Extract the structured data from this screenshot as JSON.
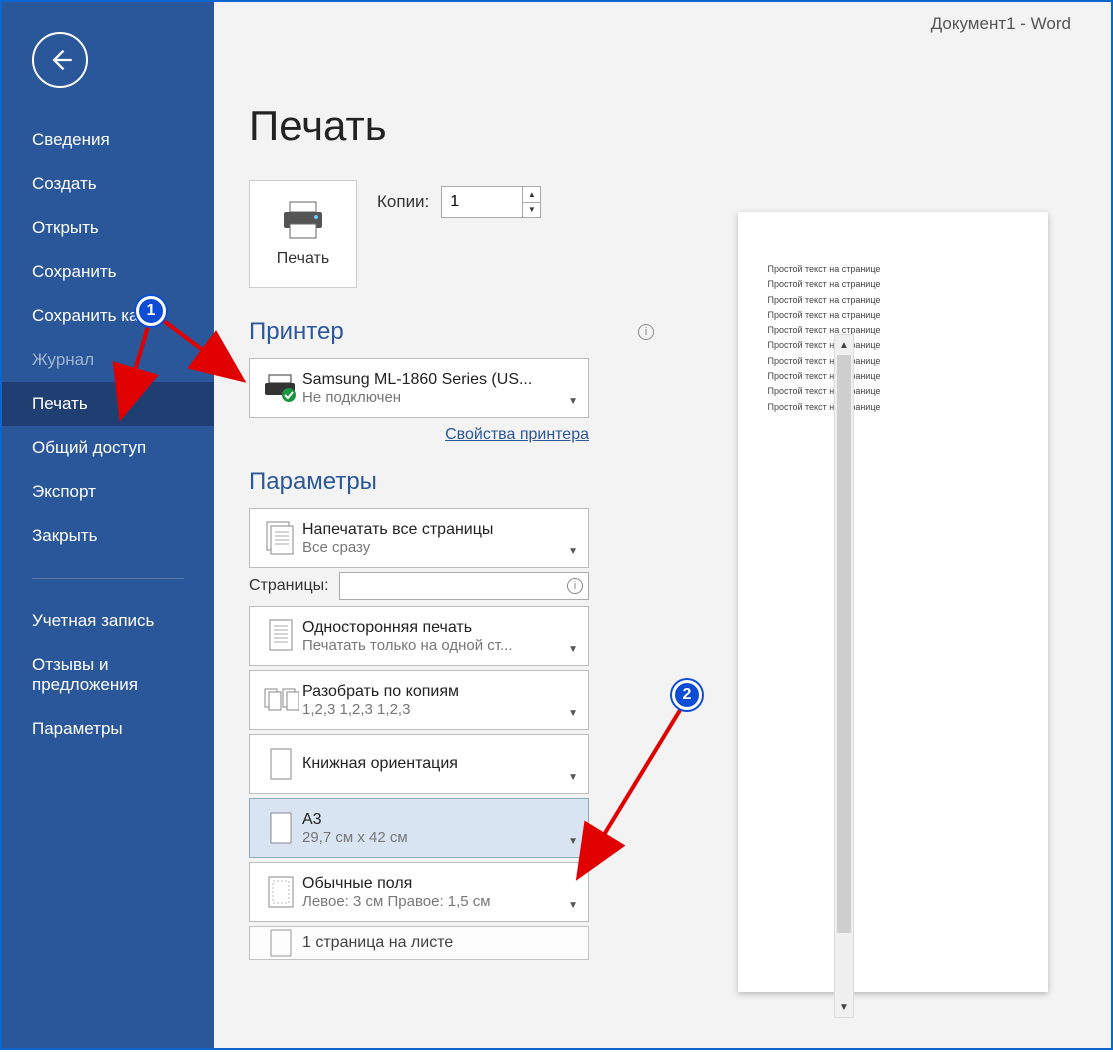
{
  "title_bar": "Документ1  -  Word",
  "sidebar": {
    "items": [
      {
        "label": "Сведения"
      },
      {
        "label": "Создать"
      },
      {
        "label": "Открыть"
      },
      {
        "label": "Сохранить"
      },
      {
        "label": "Сохранить как"
      },
      {
        "label": "Журнал",
        "disabled": true
      },
      {
        "label": "Печать",
        "active": true
      },
      {
        "label": "Общий доступ"
      },
      {
        "label": "Экспорт"
      },
      {
        "label": "Закрыть"
      }
    ],
    "secondary": [
      {
        "label": "Учетная запись"
      },
      {
        "label": "Отзывы и предложения"
      },
      {
        "label": "Параметры"
      }
    ]
  },
  "page_title": "Печать",
  "print_button_label": "Печать",
  "copies": {
    "label": "Копии:",
    "value": "1"
  },
  "printer_section": "Принтер",
  "printer": {
    "name": "Samsung ML-1860 Series (US...",
    "status": "Не подключен"
  },
  "printer_properties_link": "Свойства принтера",
  "settings_section": "Параметры",
  "settings": {
    "pages_all": {
      "main": "Напечатать все страницы",
      "sub": "Все сразу"
    },
    "pages_label": "Страницы:",
    "pages_value": "",
    "duplex": {
      "main": "Односторонняя печать",
      "sub": "Печатать только на одной ст..."
    },
    "collate": {
      "main": "Разобрать по копиям",
      "sub": "1,2,3    1,2,3    1,2,3"
    },
    "orientation": {
      "main": "Книжная ориентация"
    },
    "paper": {
      "main": "A3",
      "sub": "29,7 см x 42 см"
    },
    "margins": {
      "main": "Обычные поля",
      "sub": "Левое:  3 см    Правое:  1,5 см"
    },
    "per_sheet": {
      "main": "1 страница на листе"
    }
  },
  "preview_line": "Простой текст на странице",
  "annotations": {
    "badge1": "1",
    "badge2": "2"
  }
}
